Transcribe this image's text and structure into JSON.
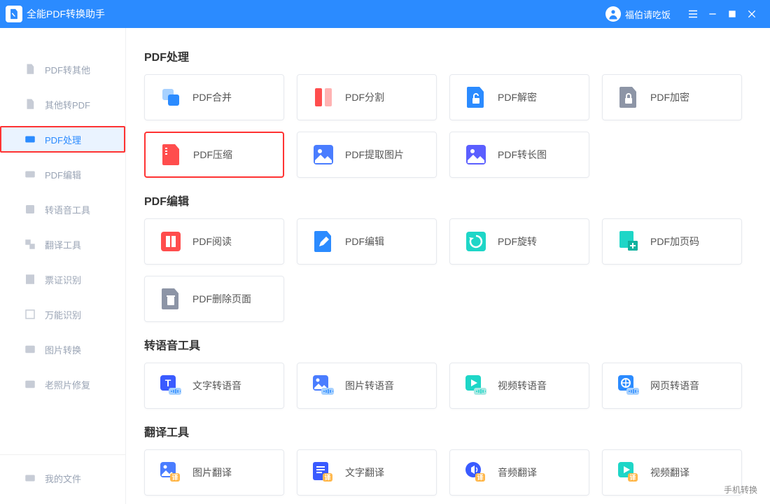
{
  "titlebar": {
    "app_title": "全能PDF转换助手",
    "username": "福伯请吃饭"
  },
  "sidebar": {
    "items": [
      {
        "label": "PDF转其他"
      },
      {
        "label": "其他转PDF"
      },
      {
        "label": "PDF处理"
      },
      {
        "label": "PDF编辑"
      },
      {
        "label": "转语音工具"
      },
      {
        "label": "翻译工具"
      },
      {
        "label": "票证识别"
      },
      {
        "label": "万能识别"
      },
      {
        "label": "图片转换"
      },
      {
        "label": "老照片修复"
      }
    ],
    "footer_label": "我的文件"
  },
  "sections": {
    "s1": {
      "title": "PDF处理",
      "cards": [
        {
          "label": "PDF合并"
        },
        {
          "label": "PDF分割"
        },
        {
          "label": "PDF解密"
        },
        {
          "label": "PDF加密"
        },
        {
          "label": "PDF压缩"
        },
        {
          "label": "PDF提取图片"
        },
        {
          "label": "PDF转长图"
        }
      ]
    },
    "s2": {
      "title": "PDF编辑",
      "cards": [
        {
          "label": "PDF阅读"
        },
        {
          "label": "PDF编辑"
        },
        {
          "label": "PDF旋转"
        },
        {
          "label": "PDF加页码"
        },
        {
          "label": "PDF删除页面"
        }
      ]
    },
    "s3": {
      "title": "转语音工具",
      "cards": [
        {
          "label": "文字转语音"
        },
        {
          "label": "图片转语音"
        },
        {
          "label": "视频转语音"
        },
        {
          "label": "网页转语音"
        }
      ]
    },
    "s4": {
      "title": "翻译工具",
      "cards": [
        {
          "label": "图片翻译"
        },
        {
          "label": "文字翻译"
        },
        {
          "label": "音频翻译"
        },
        {
          "label": "视频翻译"
        }
      ]
    }
  },
  "footer": {
    "phone_link": "手机转换"
  }
}
